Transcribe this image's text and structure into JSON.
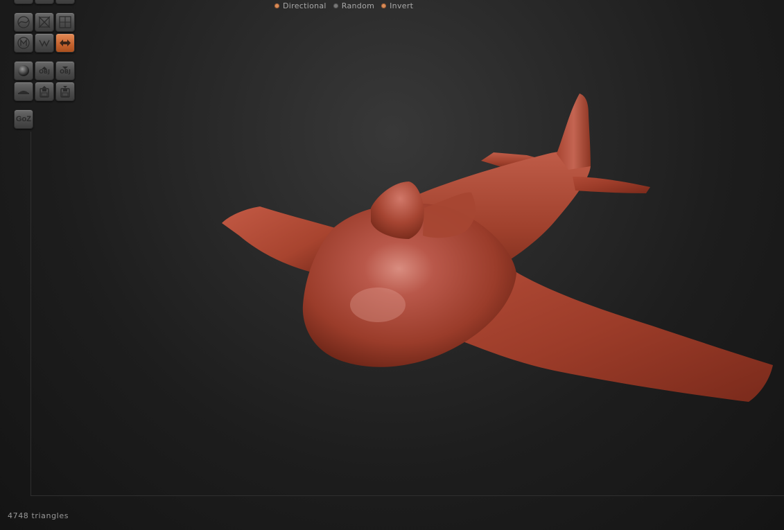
{
  "top_options": [
    {
      "label": "Directional",
      "selected": true
    },
    {
      "label": "Random",
      "selected": false
    },
    {
      "label": "Invert",
      "selected": true
    }
  ],
  "palette": {
    "row0": [
      "curve-icon",
      "x-icon",
      "grid-icon"
    ],
    "row1": [
      "m-symmetry-icon",
      "w-icon",
      "double-arrow-icon"
    ],
    "row2": [
      "sphere-icon",
      "obj-import-icon",
      "obj-export-icon"
    ],
    "row3": [
      "floor-icon",
      "save-import-icon",
      "save-export-icon"
    ],
    "obj_label": "OBJ",
    "goz_label": "GoZ",
    "active_color": "#c8693a"
  },
  "model": {
    "name": "airplane",
    "color": "#a5412d"
  },
  "status": {
    "triangle_count": "4748 triangles"
  }
}
